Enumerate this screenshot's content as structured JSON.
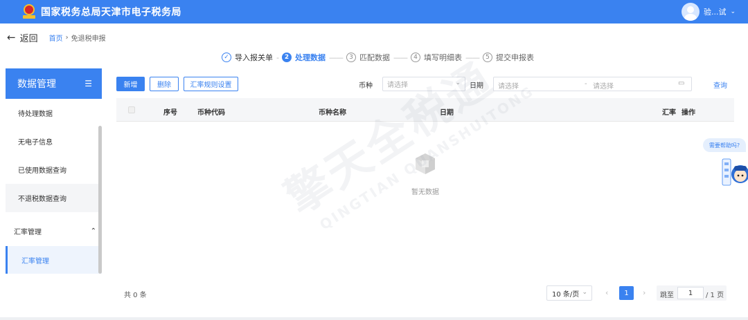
{
  "header": {
    "title": "国家税务总局天津市电子税务局",
    "user_name": "验...试"
  },
  "breadcrumb": {
    "back_label": "返回",
    "home": "首页",
    "separator": "›",
    "current": "免退税申报"
  },
  "steps": [
    {
      "index": "✓",
      "label": "导入报关单",
      "state": "done"
    },
    {
      "index": "2",
      "label": "处理数据",
      "state": "active"
    },
    {
      "index": "3",
      "label": "匹配数据",
      "state": "pending"
    },
    {
      "index": "4",
      "label": "填写明细表",
      "state": "pending"
    },
    {
      "index": "5",
      "label": "提交申报表",
      "state": "pending"
    }
  ],
  "sidebar": {
    "title": "数据管理",
    "items": [
      {
        "label": "待处理数据"
      },
      {
        "label": "无电子信息"
      },
      {
        "label": "已使用数据查询"
      },
      {
        "label": "不退税数据查询"
      }
    ],
    "group": {
      "label": "汇率管理",
      "sub_items": [
        {
          "label": "汇率管理"
        }
      ]
    }
  },
  "toolbar": {
    "add_label": "新增",
    "delete_label": "删除",
    "rule_label": "汇率规则设置",
    "currency_label": "币种",
    "currency_placeholder": "请选择",
    "date_label": "日期",
    "date_start_placeholder": "请选择",
    "date_sep": "-",
    "date_end_placeholder": "请选择",
    "query_label": "查询"
  },
  "table": {
    "columns": {
      "seq": "序号",
      "code": "币种代码",
      "name": "币种名称",
      "date": "日期",
      "rate": "汇率",
      "ops": "操作"
    },
    "rows": [],
    "empty_text": "暂无数据"
  },
  "watermark": {
    "main": "擎天全税通",
    "sub": "QINGTIAN QUANSHUITONG"
  },
  "pagination": {
    "total_text": "共 0 条",
    "page_size": "10 条/页",
    "current_page": "1",
    "jump_label": "跳至",
    "jump_value": "1",
    "page_count_text": "/ 1 页"
  },
  "help": {
    "bubble": "需要帮助吗?"
  },
  "colors": {
    "primary": "#3a82f0",
    "brand_red": "#d8262a",
    "brand_gold": "#f3c02d"
  }
}
